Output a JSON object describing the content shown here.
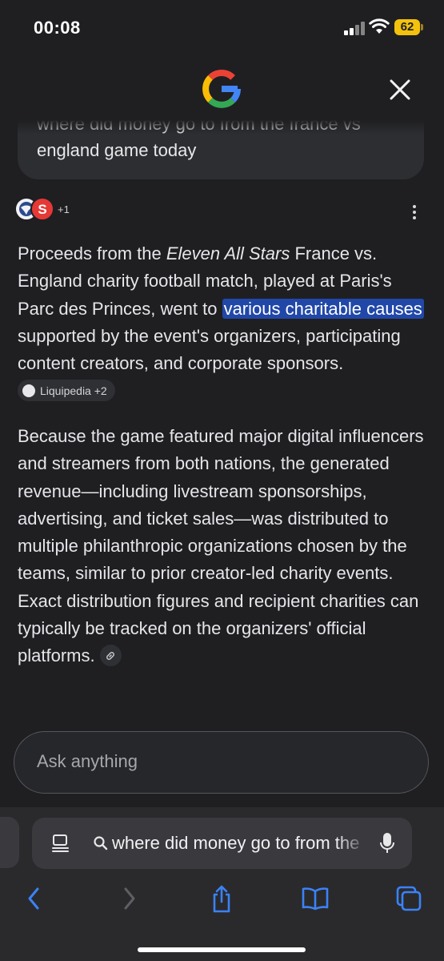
{
  "status_bar": {
    "time": "00:08",
    "battery": "62"
  },
  "query": "where did money go to from the france vs england game today",
  "sources": {
    "count_label": "+1"
  },
  "answer": {
    "p1_before": "Proceeds from the ",
    "p1_italic": "Eleven All Stars",
    "p1_mid": " France vs. England charity football match, played at Paris's Parc des Princes, went to ",
    "p1_highlight": "various charitable causes",
    "p1_after": " supported by the event's organizers, participating content creators, and corporate sponsors. ",
    "citation_label": "Liquipedia +2",
    "p2": "Because the game featured major digital influencers and streamers from both nations, the generated revenue—including livestream sponsorships, advertising, and ticket sales—was distributed to multiple philanthropic organizations chosen by the teams, similar to prior creator-led charity events. Exact distribution figures and recipient charities can typically be tracked on the organizers' official platforms. "
  },
  "ask_box": {
    "placeholder": "Ask anything"
  },
  "address_bar": {
    "text": "where did money go to from the france vs england game today"
  },
  "icons": {
    "logo": "google-g-logo",
    "close": "close-icon",
    "more": "more-vert-icon",
    "reader": "reader-mode-icon",
    "search": "search-icon",
    "mic": "microphone-icon",
    "back": "chevron-left-icon",
    "forward": "chevron-right-icon",
    "share": "share-icon",
    "bookmarks": "book-icon",
    "tabs": "tabs-icon"
  },
  "colors": {
    "background": "#1f1f22",
    "highlight": "#2148a8",
    "accent_blue": "#3b82f6",
    "battery": "#f4c20d"
  }
}
